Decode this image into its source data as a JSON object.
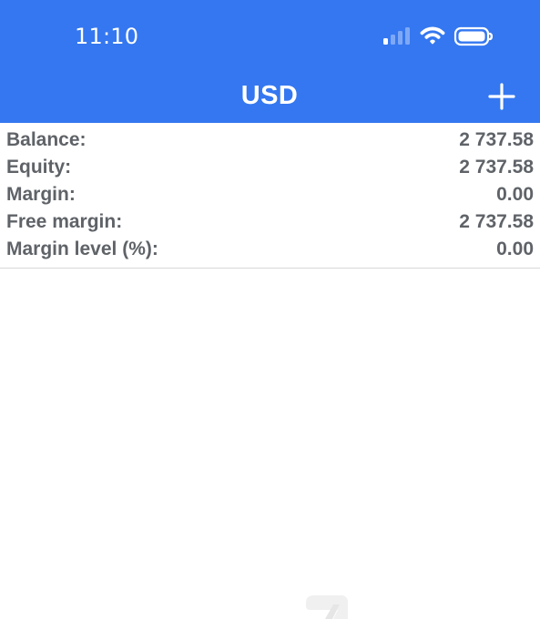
{
  "status_bar": {
    "time": "11:10",
    "icons": [
      "signal-icon",
      "wifi-icon",
      "battery-icon"
    ]
  },
  "header": {
    "title": "USD",
    "action_icon": "plus-icon",
    "background_color": "#3477f0",
    "text_color": "#ffffff"
  },
  "account_summary": {
    "rows": [
      {
        "label": "Balance:",
        "value": "2 737.58"
      },
      {
        "label": "Equity:",
        "value": "2 737.58"
      },
      {
        "label": "Margin:",
        "value": "0.00"
      },
      {
        "label": "Free margin:",
        "value": "2 737.58"
      },
      {
        "label": "Margin level (%):",
        "value": "0.00"
      }
    ],
    "text_color": "#5f6368"
  },
  "decorations": {
    "bottom_logo_fragment_icon": "brand-logo-icon",
    "bottom_logo_color": "#f0f0f0"
  }
}
